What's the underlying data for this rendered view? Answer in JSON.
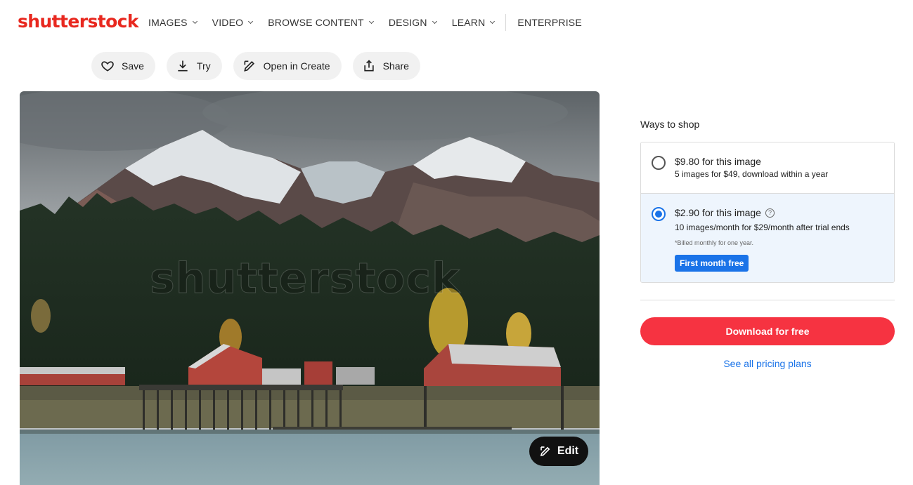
{
  "brand": {
    "logo_text": "shutterstock",
    "accent": "#e8281f"
  },
  "nav": {
    "items": [
      {
        "label": "IMAGES",
        "has_dropdown": true
      },
      {
        "label": "VIDEO",
        "has_dropdown": true
      },
      {
        "label": "BROWSE CONTENT",
        "has_dropdown": true
      },
      {
        "label": "DESIGN",
        "has_dropdown": true
      },
      {
        "label": "LEARN",
        "has_dropdown": true
      }
    ],
    "enterprise": "ENTERPRISE"
  },
  "actions": {
    "save": {
      "label": "Save",
      "icon": "heart-icon"
    },
    "try": {
      "label": "Try",
      "icon": "download-icon"
    },
    "open_create": {
      "label": "Open in Create",
      "icon": "create-edit-icon"
    },
    "share": {
      "label": "Share",
      "icon": "share-icon"
    }
  },
  "image": {
    "watermark": "shutterstock",
    "edit_label": "Edit"
  },
  "shop": {
    "heading": "Ways to shop",
    "options": [
      {
        "title": "$9.80 for this image",
        "subtitle": "5 images for $49, download within a year",
        "selected": false
      },
      {
        "title": "$2.90 for this image",
        "subtitle": "10 images/month for $29/month after trial ends",
        "note": "*Billed monthly for one year.",
        "badge": "First month free",
        "selected": true
      }
    ],
    "download_label": "Download for free",
    "pricing_link": "See all pricing plans",
    "colors": {
      "download": "#f63341",
      "link": "#1a73e8",
      "selected_bg": "#eef5fd"
    }
  }
}
